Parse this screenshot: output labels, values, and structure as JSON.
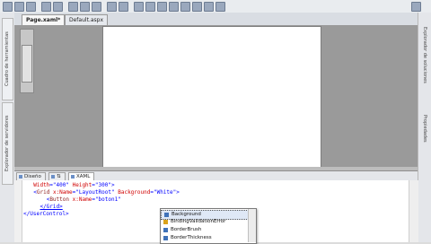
{
  "left_panel": {
    "labels": [
      "Cuadro de herramientas",
      "Explorador de servidores"
    ]
  },
  "right_panel": {
    "labels": [
      "Explorador de soluciones",
      "Propiedades"
    ]
  },
  "doc_tabs": [
    "Page.xaml*",
    "Default.aspx"
  ],
  "split_tabs": [
    "Diseño",
    "⇅",
    "XAML"
  ],
  "code": {
    "line1": {
      "attr1": "Width",
      "val1": "\"400\"",
      "attr2": "Height",
      "val2": "\"300\""
    },
    "line2": {
      "tag": "Grid",
      "attr1": "x:Name",
      "val1": "\"LayoutRoot\"",
      "attr2": "Background",
      "val2": "\"White\""
    },
    "line3": {
      "tag": "Button",
      "attr1": "x:Name",
      "val1": "\"boton1\""
    },
    "line4": {
      "text": "</Grid>"
    },
    "line5": {
      "text": "</UserControl>"
    }
  },
  "intellisense": {
    "items": [
      "Background",
      "BindingValidationError",
      "BorderBrush",
      "BorderThickness"
    ],
    "selected_index": 0
  }
}
